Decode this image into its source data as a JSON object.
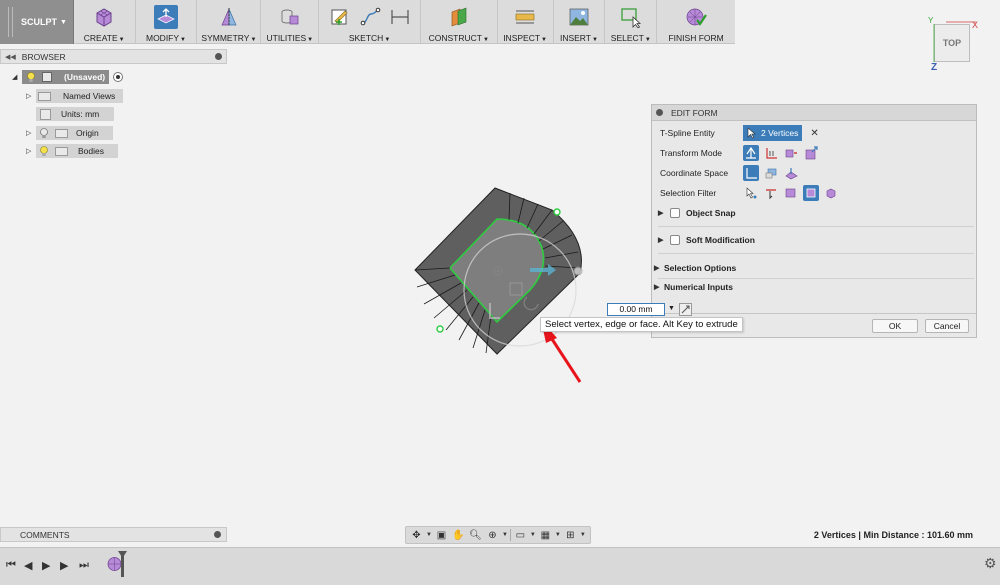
{
  "toolbar": {
    "workspace": "SCULPT",
    "groups": [
      {
        "label": "CREATE"
      },
      {
        "label": "MODIFY"
      },
      {
        "label": "SYMMETRY"
      },
      {
        "label": "UTILITIES"
      },
      {
        "label": "SKETCH"
      },
      {
        "label": "CONSTRUCT"
      },
      {
        "label": "INSPECT"
      },
      {
        "label": "INSERT"
      },
      {
        "label": "SELECT"
      },
      {
        "label": "FINISH FORM"
      }
    ]
  },
  "browser": {
    "title": "BROWSER",
    "root": "(Unsaved)",
    "items": [
      {
        "label": "Named Views"
      },
      {
        "label": "Units: mm"
      },
      {
        "label": "Origin"
      },
      {
        "label": "Bodies"
      }
    ]
  },
  "viewcube": {
    "face": "TOP",
    "x": "X",
    "z": "Z"
  },
  "edit_form": {
    "title": "EDIT FORM",
    "tspline_label": "T-Spline Entity",
    "tspline_value": "2 Vertices",
    "transform_label": "Transform Mode",
    "coord_label": "Coordinate Space",
    "filter_label": "Selection Filter",
    "object_snap": "Object Snap",
    "soft_mod": "Soft Modification",
    "selection_options": "Selection Options",
    "numerical_inputs": "Numerical Inputs",
    "ok": "OK",
    "cancel": "Cancel"
  },
  "manipulator": {
    "distance": "0.00 mm"
  },
  "tooltip": "Select vertex, edge or face. Alt Key to extrude",
  "comments": {
    "title": "COMMENTS"
  },
  "status": "2 Vertices | Min Distance : 101.60 mm",
  "colors": {
    "accent": "#3b7cb9",
    "selection": "#2ecc40",
    "arrow": "#e8141c",
    "body": "#5f5f5f"
  }
}
